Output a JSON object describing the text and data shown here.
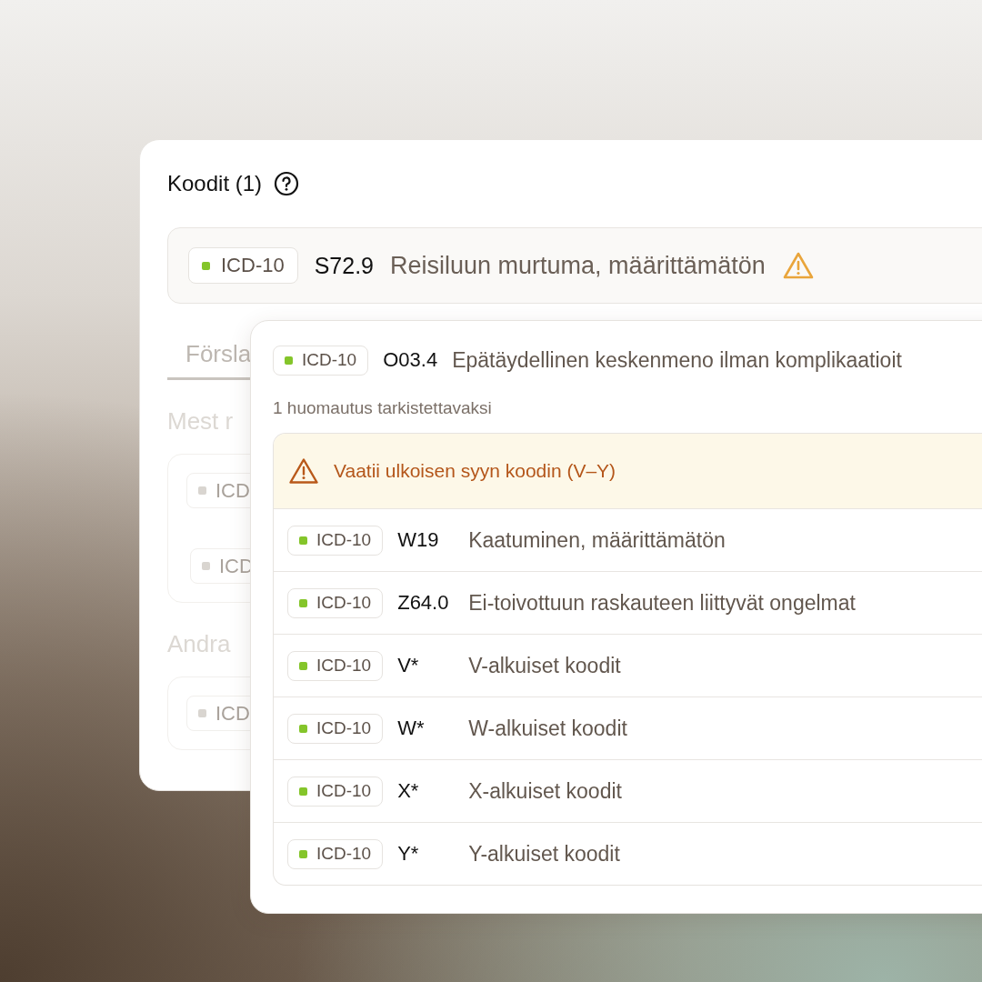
{
  "panel": {
    "title": "Koodit (1)",
    "selected_code": {
      "system": "ICD-10",
      "color": "#84c52a",
      "code": "S72.9",
      "description": "Reisiluun murtuma, määrittämätön",
      "warning": true
    },
    "tabs": [
      {
        "label": "Försla",
        "selected": true
      }
    ],
    "sections": [
      {
        "title": "Mest r",
        "items": [
          {
            "system": "ICD",
            "color": "#d9d5d0"
          },
          {
            "system": "ICD",
            "color": "#d9d5d0"
          }
        ]
      },
      {
        "title": "Andra",
        "items": [
          {
            "system": "ICD",
            "color": "#d9d5d0"
          }
        ]
      }
    ]
  },
  "popup": {
    "code": {
      "system": "ICD-10",
      "color": "#84c52a",
      "code": "O03.4",
      "description": "Epätäydellinen keskenmeno ilman komplikaatioit"
    },
    "note": "1 huomautus tarkistettavaksi",
    "warning": "Vaatii ulkoisen syyn koodin (V–Y)",
    "suggestions": [
      {
        "system": "ICD-10",
        "color": "#84c52a",
        "code": "W19",
        "description": "Kaatuminen, määrittämätön"
      },
      {
        "system": "ICD-10",
        "color": "#84c52a",
        "code": "Z64.0",
        "description": "Ei-toivottuun raskauteen liittyvät ongelmat"
      },
      {
        "system": "ICD-10",
        "color": "#84c52a",
        "code": "V*",
        "description": "V-alkuiset koodit"
      },
      {
        "system": "ICD-10",
        "color": "#84c52a",
        "code": "W*",
        "description": "W-alkuiset koodit"
      },
      {
        "system": "ICD-10",
        "color": "#84c52a",
        "code": "X*",
        "description": "X-alkuiset koodit"
      },
      {
        "system": "ICD-10",
        "color": "#84c52a",
        "code": "Y*",
        "description": "Y-alkuiset koodit"
      }
    ]
  }
}
